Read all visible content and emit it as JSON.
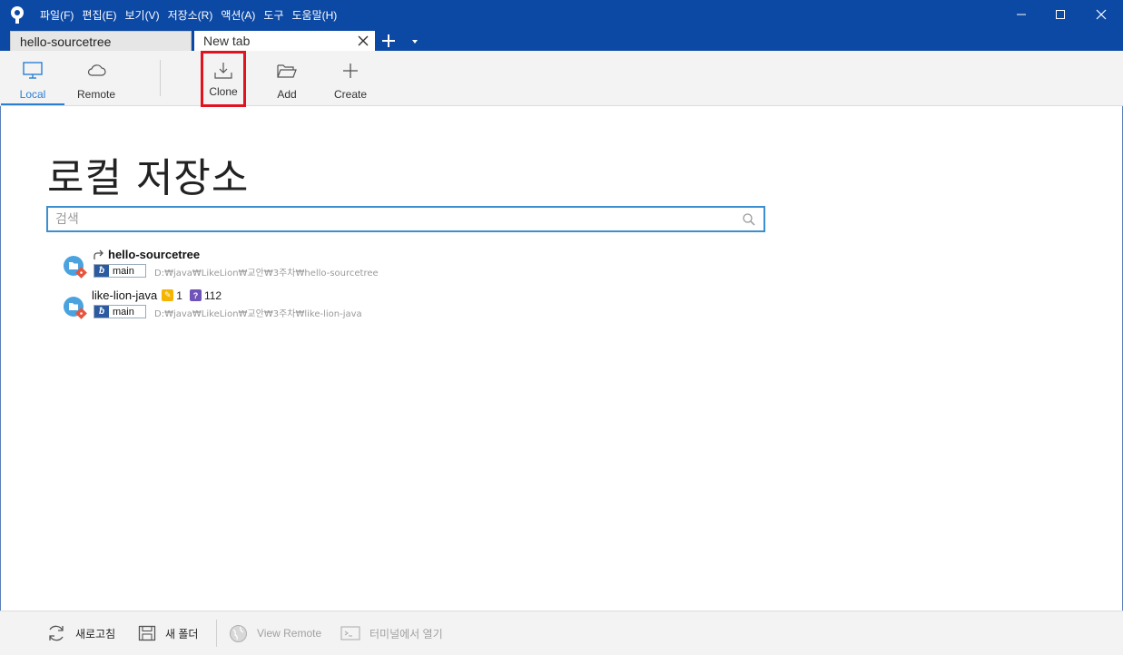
{
  "menu": [
    "파일(F)",
    "편집(E)",
    "보기(V)",
    "저장소(R)",
    "액션(A)",
    "도구",
    "도움말(H)"
  ],
  "tabs": {
    "repo_tab": "hello-sourcetree",
    "new_tab": "New tab"
  },
  "toolbar": {
    "local": "Local",
    "remote": "Remote",
    "clone": "Clone",
    "add": "Add",
    "create": "Create"
  },
  "main": {
    "title": "로컬 저장소",
    "search_placeholder": "검색"
  },
  "repos": [
    {
      "name": "hello-sourcetree",
      "branch": "main",
      "path": "D:₩java₩LikeLion₩교안₩3주차₩hello-sourcetree"
    },
    {
      "name": "like-lion-java",
      "branch": "main",
      "path": "D:₩java₩LikeLion₩교안₩3주차₩like-lion-java",
      "modified_count": "1",
      "untracked_count": "112"
    }
  ],
  "bottom": {
    "refresh": "새로고침",
    "new_folder": "새 폴더",
    "view_remote": "View Remote",
    "terminal": "터미널에서 열기"
  },
  "colors": {
    "titlebar": "#0c49a5",
    "accent": "#2a7fd4",
    "highlight": "#e0131e"
  }
}
